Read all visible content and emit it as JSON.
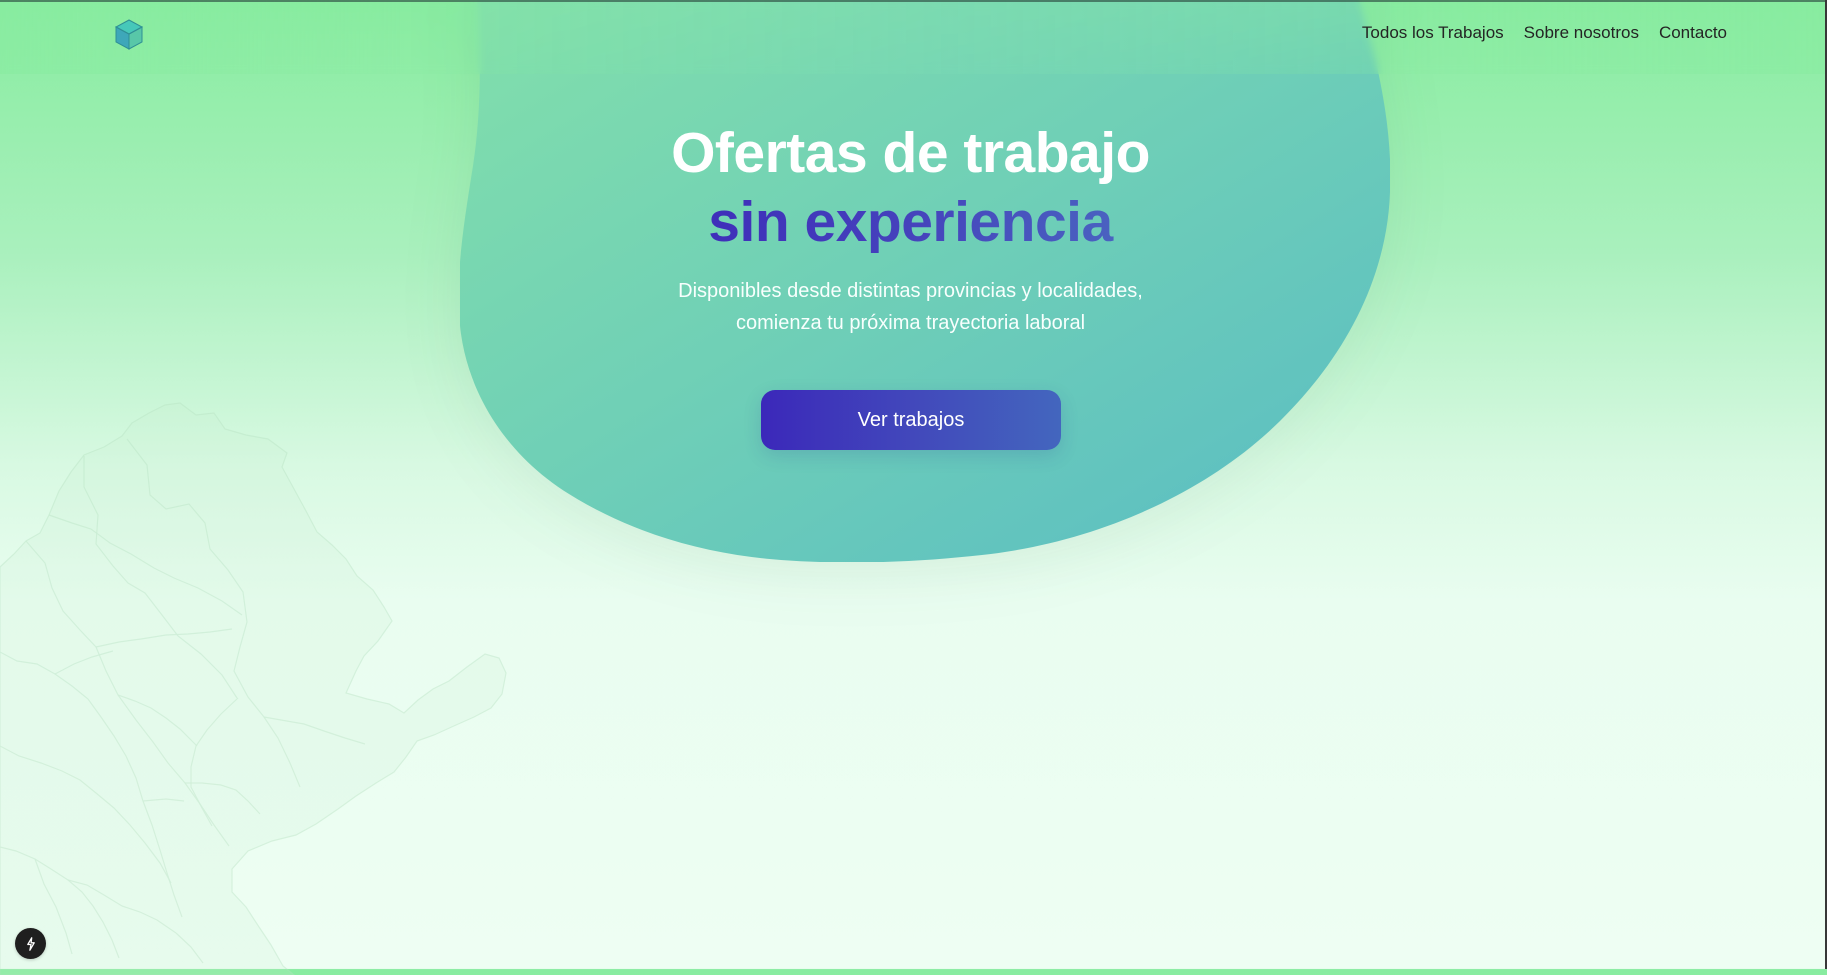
{
  "header": {
    "logo_icon": "cube-icon",
    "nav_items": [
      {
        "label": "Todos los Trabajos"
      },
      {
        "label": "Sobre nosotros"
      },
      {
        "label": "Contacto"
      }
    ]
  },
  "hero": {
    "title_primary": "Ofertas de trabajo",
    "title_secondary": "sin experiencia",
    "subtitle_line_1": "Disponibles desde distintas provincias y localidades,",
    "subtitle_line_2": "comienza tu próxima trayectoria laboral",
    "cta_label": "Ver trabajos"
  },
  "floating_tool": {
    "icon": "lightning-icon"
  },
  "colors": {
    "page_top": "#88eca0",
    "page_bottom": "#eefef3",
    "hero_blob_top": "#7ddcaf",
    "hero_blob_bottom": "#5cbcc2",
    "accent_purple": "#3b28ba",
    "accent_blue": "#4366be",
    "text_dark": "#242424",
    "white": "#ffffff"
  }
}
